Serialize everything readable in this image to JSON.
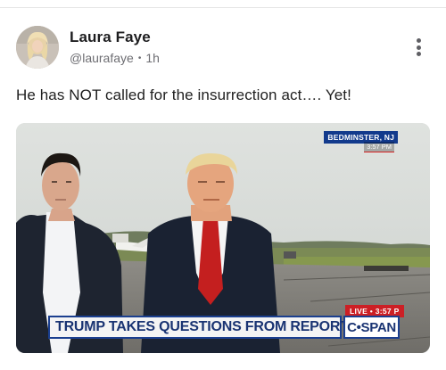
{
  "post": {
    "author": {
      "display_name": "Laura Faye",
      "handle": "@laurafaye",
      "time_ago": "1h",
      "separator": "•"
    },
    "text": "He has NOT called for the insurrection act…. Yet!",
    "media": {
      "location_tag": "BEDMINSTER, NJ",
      "location_time": "3:57 PM",
      "live_tag": "LIVE • 3:57 P",
      "chyron": "TRUMP TAKES QUESTIONS FROM REPORTERS",
      "network_logo": "C•SPAN"
    }
  },
  "icons": {
    "more": "more-vertical-icon",
    "avatar": "user-avatar"
  },
  "colors": {
    "chyron_blue": "#1b3f8f",
    "live_red": "#cc1f25",
    "text_primary": "#1f1f1f",
    "text_secondary": "#6d6d72"
  }
}
